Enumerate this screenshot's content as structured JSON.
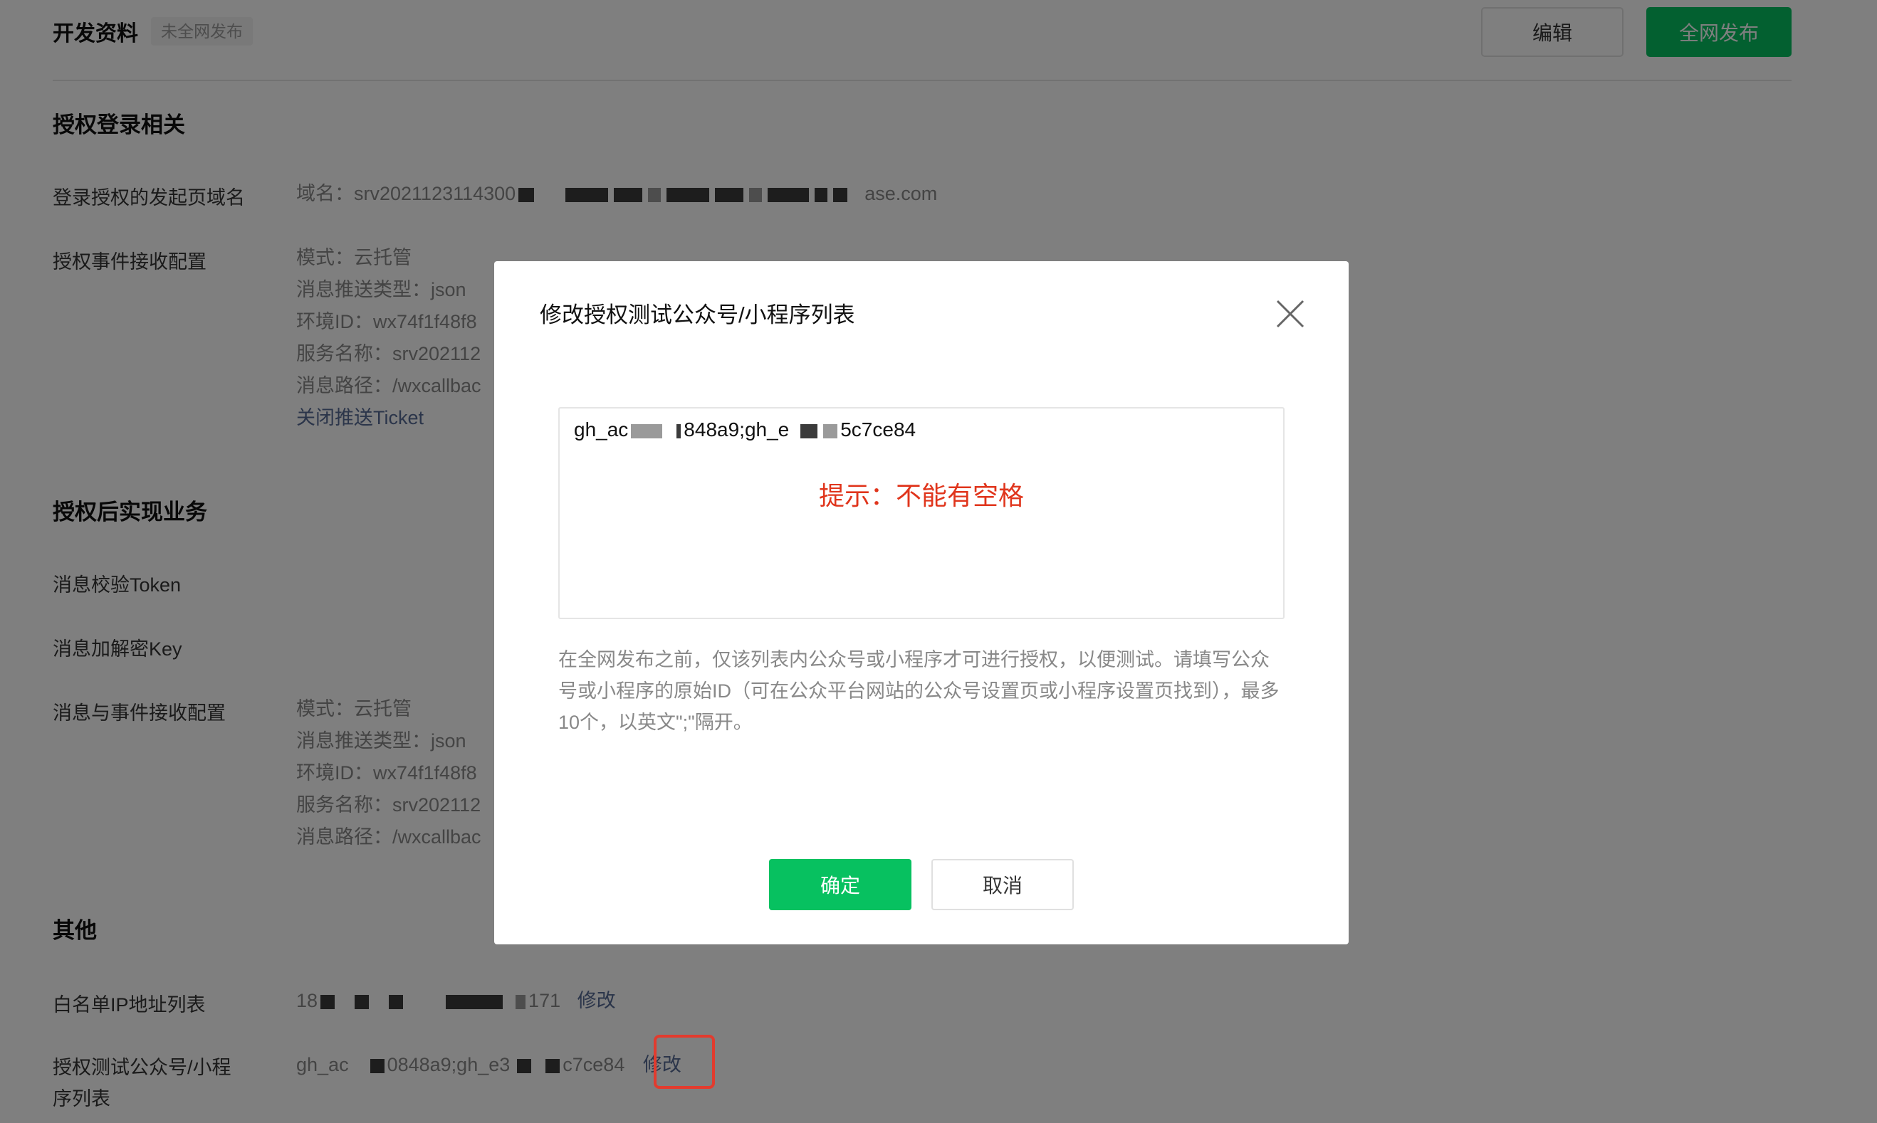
{
  "header": {
    "title": "开发资料",
    "status_badge": "未全网发布",
    "edit_label": "编辑",
    "publish_label": "全网发布"
  },
  "auth_login": {
    "section_title": "授权登录相关",
    "domain_label": "登录授权的发起页域名",
    "domain_prefix": "域名：srv2021123114300",
    "domain_suffix": "ase.com",
    "event_label": "授权事件接收配置",
    "mode": "模式：云托管",
    "push_type": "消息推送类型：json",
    "env_id": "环境ID：wx74f1f48f8",
    "service_name": "服务名称：srv202112",
    "path": "消息路径：/wxcallbac",
    "close_ticket_link": "关闭推送Ticket"
  },
  "business": {
    "section_title": "授权后实现业务",
    "token_label": "消息校验Token",
    "key_label": "消息加解密Key",
    "event_label": "消息与事件接收配置",
    "mode": "模式：云托管",
    "push_type": "消息推送类型：json",
    "env_id": "环境ID：wx74f1f48f8",
    "service_name": "服务名称：srv202112",
    "path": "消息路径：/wxcallbac"
  },
  "other": {
    "section_title": "其他",
    "whitelist_label": "白名单IP地址列表",
    "whitelist_prefix": "18",
    "whitelist_suffix": "171",
    "whitelist_modify": "修改",
    "test_list_label_line1": "授权测试公众号/小程",
    "test_list_label_line2": "序列表",
    "test_list_p1": "gh_ac",
    "test_list_p2": "0848a9;gh_e3",
    "test_list_p3": "c7ce84",
    "test_list_modify": "修改"
  },
  "dialog": {
    "title": "修改授权测试公众号/小程序列表",
    "input_part1": "gh_ac",
    "input_part2": "848a9;gh_e",
    "input_part3": "5c7ce84",
    "hint": "提示：不能有空格",
    "description": "在全网发布之前，仅该列表内公众号或小程序才可进行授权，以便测试。请填写公众号或小程序的原始ID（可在公众平台网站的公众号设置页或小程序设置页找到），最多10个，以英文\";\"隔开。",
    "ok_label": "确定",
    "cancel_label": "取消"
  },
  "colors": {
    "accent_green": "#07c160",
    "link_blue": "#576b95",
    "hint_red": "#e0351c",
    "highlight_red": "#e23b2e"
  },
  "icons": {
    "close": "close-icon"
  }
}
